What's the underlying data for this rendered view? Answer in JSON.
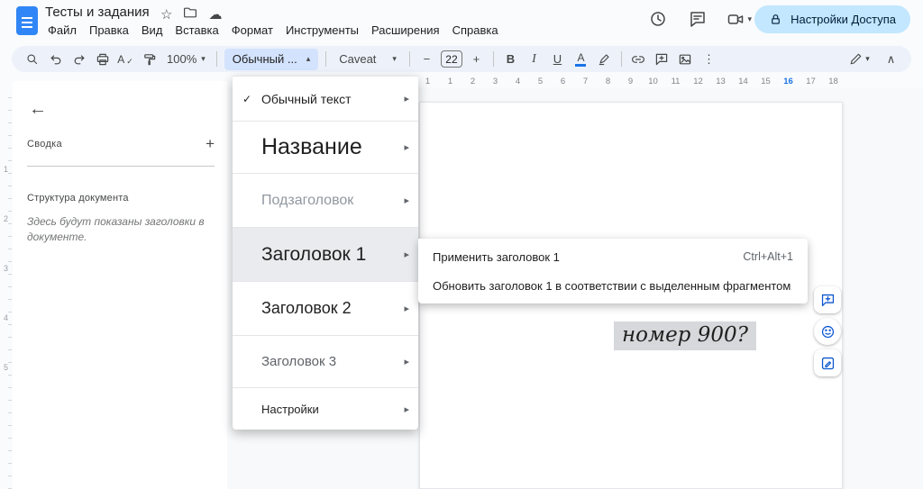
{
  "icons": {
    "star": "☆",
    "cloud": "☁",
    "check": "✓",
    "arrow_right": "▸",
    "caret_down": "▾",
    "caret_up": "▴",
    "back": "←",
    "plus": "+",
    "minus": "−",
    "more": "⋮",
    "collapse": "∧",
    "bold": "B",
    "italic": "I",
    "underline": "U",
    "color_letter": "A",
    "spell_letter": "A",
    "spell_check": "✓"
  },
  "colors": {
    "accent_blue": "#1a73e8",
    "share_bg": "#c2e7ff",
    "toolbar_bg": "#edf2fa",
    "styles_btn_bg": "#d3e3fd",
    "highlight_gray": "#d6d8db"
  },
  "header": {
    "doc_title": "Тесты и задания",
    "menus": [
      {
        "label": "Файл"
      },
      {
        "label": "Правка"
      },
      {
        "label": "Вид"
      },
      {
        "label": "Вставка"
      },
      {
        "label": "Формат"
      },
      {
        "label": "Инструменты"
      },
      {
        "label": "Расширения"
      },
      {
        "label": "Справка"
      }
    ],
    "share_label": "Настройки Доступа"
  },
  "toolbar": {
    "zoom_value": "100%",
    "styles_value": "Обычный ...",
    "font_value": "Caveat",
    "font_size_value": "22"
  },
  "sidebar": {
    "summary_label": "Сводка",
    "outline_title": "Структура документа",
    "outline_placeholder": "Здесь будут показаны заголовки в документе."
  },
  "ruler": {
    "horizontal": [
      {
        "t": "1"
      },
      {
        "t": "1"
      },
      {
        "t": "2"
      },
      {
        "t": "3"
      },
      {
        "t": "4"
      },
      {
        "t": "5"
      },
      {
        "t": "6"
      },
      {
        "t": "7"
      },
      {
        "t": "8"
      },
      {
        "t": "9"
      },
      {
        "t": "10"
      },
      {
        "t": "11"
      },
      {
        "t": "12"
      },
      {
        "t": "13"
      },
      {
        "t": "14"
      },
      {
        "t": "15"
      },
      {
        "t": "16",
        "cls": "accent"
      },
      {
        "t": "17"
      },
      {
        "t": "18"
      }
    ],
    "vertical": [
      {
        "t": "1"
      },
      {
        "t": "2"
      },
      {
        "t": "3"
      },
      {
        "t": "4"
      },
      {
        "t": "5"
      }
    ]
  },
  "styles_menu": {
    "items": [
      {
        "label": "Обычный текст",
        "cls": "s-normal",
        "check": "✓"
      },
      {
        "label": "Название",
        "cls": "s-title"
      },
      {
        "label": "Подзаголовок",
        "cls": "s-subtitle"
      },
      {
        "label": "Заголовок 1",
        "cls": "s-h1 selected"
      },
      {
        "label": "Заголовок 2",
        "cls": "s-h2"
      },
      {
        "label": "Заголовок 3",
        "cls": "s-h3"
      },
      {
        "label": "Настройки",
        "cls": "s-settings"
      }
    ]
  },
  "submenu": {
    "items": [
      {
        "label": "Применить заголовок 1",
        "shortcut": "Ctrl+Alt+1"
      },
      {
        "label": "Обновить заголовок 1 в соответствии с выделенным фрагментом",
        "shortcut": ""
      }
    ]
  },
  "document": {
    "visible_text": "номер 900?"
  }
}
